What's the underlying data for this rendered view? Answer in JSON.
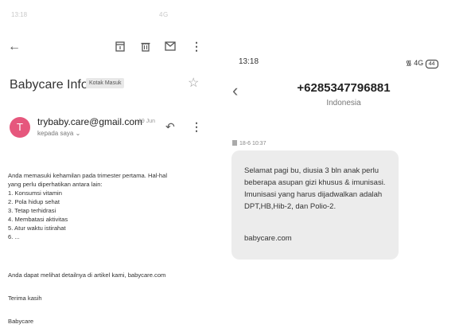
{
  "email": {
    "status": {
      "time": "13:18",
      "network": "4G"
    },
    "subject": "Babycare Info",
    "label": "Kotak Masuk",
    "avatar_letter": "T",
    "sender": "trybaby.care@gmail.com",
    "date": "19 Jun",
    "to": "kepada saya",
    "body_intro_1": "Anda memasuki kehamilan pada trimester pertama. Hal-hal",
    "body_intro_2": "yang perlu diperhatikan antara lain:",
    "list": [
      "1. Konsumsi vitamin",
      "2. Pola hidup sehat",
      "3. Tetap terhidrasi",
      "4. Membatasi aktivitas",
      "5. Atur waktu istirahat",
      "6. ..."
    ],
    "closing_line": "Anda dapat melihat detailnya di artikel kami, babycare.com",
    "thanks": "Terima kasih",
    "signature": "Babycare"
  },
  "sms": {
    "status": {
      "time": "13:18",
      "network": "4G",
      "battery": "44"
    },
    "phone": "+6285347796881",
    "country": "Indonesia",
    "timestamp": "18-6 10:37",
    "message_lines": [
      "Selamat pagi bu, diusia 3 bln anak perlu",
      "beberapa asupan gizi khusus & imunisasi.",
      "Imunisasi yang harus dijadwalkan adalah",
      "DPT,HB,Hib-2, dan Polio-2."
    ],
    "message_link": "babycare.com"
  }
}
